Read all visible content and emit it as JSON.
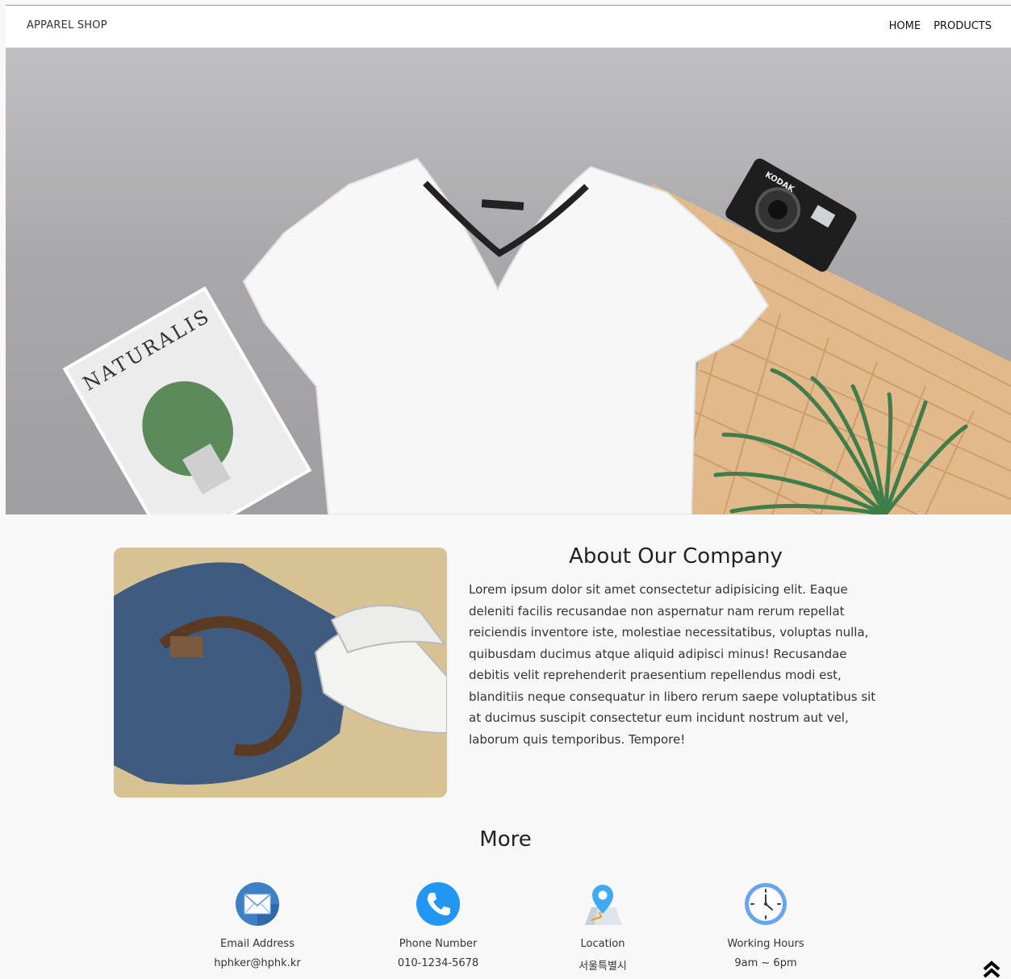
{
  "header": {
    "brand": "APPAREL SHOP",
    "nav": [
      {
        "label": "HOME"
      },
      {
        "label": "PRODUCTS"
      }
    ]
  },
  "hero": {
    "magazine_title": "NATURALIS",
    "camera_brand": "KODAK"
  },
  "about": {
    "title": "About Our Company",
    "body": "Lorem ipsum dolor sit amet consectetur adipisicing elit. Eaque deleniti facilis recusandae non aspernatur nam rerum repellat reiciendis inventore iste, molestiae necessitatibus, voluptas nulla, quibusdam ducimus atque aliquid adipisci minus! Recusandae debitis velit reprehenderit praesentium repellendus modi est, blanditiis neque consequatur in libero rerum saepe voluptatibus sit at ducimus suscipit consectetur eum incidunt nostrum aut vel, laborum quis temporibus. Tempore!"
  },
  "more": {
    "title": "More",
    "items": [
      {
        "icon": "envelope-icon",
        "label": "Email Address",
        "value": "hphker@hphk.kr"
      },
      {
        "icon": "phone-icon",
        "label": "Phone Number",
        "value": "010-1234-5678"
      },
      {
        "icon": "map-pin-icon",
        "label": "Location",
        "value": "서울특별시"
      },
      {
        "icon": "clock-icon",
        "label": "Working Hours",
        "value": "9am ~ 6pm"
      }
    ]
  },
  "colors": {
    "header_bg": "#ffffff",
    "page_bg": "#f8f8f8",
    "icon_blue": "#2196f3",
    "text": "#333333"
  },
  "back_to_top_icon": "double-chevron-up-icon"
}
